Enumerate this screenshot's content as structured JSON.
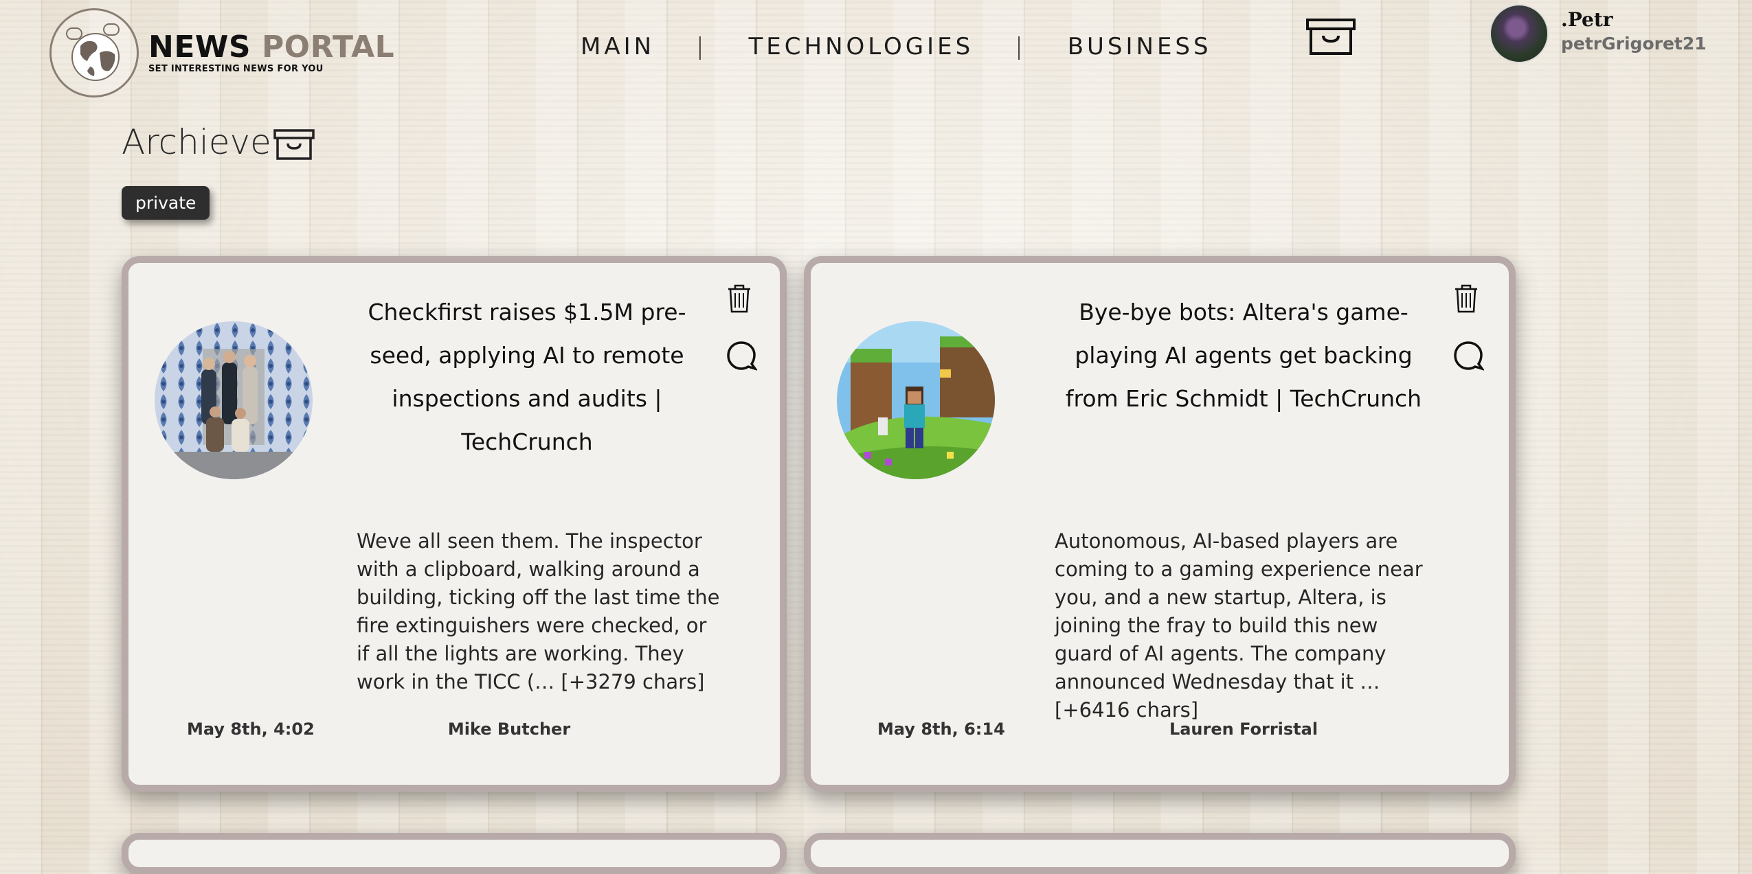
{
  "header": {
    "logo_title_main": "NEWS",
    "logo_title_accent": "PORTAL",
    "logo_subtitle": "SET INTERESTING NEWS FOR YOU",
    "nav": [
      {
        "label": "MAIN"
      },
      {
        "label": "TECHNOLOGIES"
      },
      {
        "label": "BUSINESS"
      }
    ],
    "nav_separator": "|",
    "archive_icon": "archive-box-icon"
  },
  "user": {
    "name": ".Petr",
    "handle": "petrGrigoret21"
  },
  "page": {
    "title": "Archieve",
    "title_icon": "archive-box-icon",
    "tag": "private"
  },
  "cards": [
    {
      "image": "group-photo",
      "title": "Checkfirst raises $1.5M pre-seed, applying AI to remote inspections and audits | TechCrunch",
      "description": "Weve all seen them. The inspector with a clipboard, walking around a building, ticking off the last time the fire extinguishers were checked, or if all the lights are working. They work in the TICC (… [+3279 chars]",
      "date": "May 8th, 4:02",
      "author": "Mike Butcher",
      "icons": [
        "trash-icon",
        "comment-icon"
      ]
    },
    {
      "image": "minecraft-scene",
      "title": "Bye-bye bots: Altera's game-playing AI agents get backing from Eric Schmidt | TechCrunch",
      "description": "Autonomous, AI-based players are coming to a gaming experience near you, and a new startup, Altera, is joining the fray to build this new guard of AI agents. The company announced Wednesday that it … [+6416 chars]",
      "date": "May 8th, 6:14",
      "author": "Lauren Forristal",
      "icons": [
        "trash-icon",
        "comment-icon"
      ]
    }
  ],
  "colors": {
    "accent": "#8b7e72",
    "card_border": "#b7aaa9",
    "card_bg": "#f3f1ee",
    "tag_bg": "#2e2e2e"
  }
}
